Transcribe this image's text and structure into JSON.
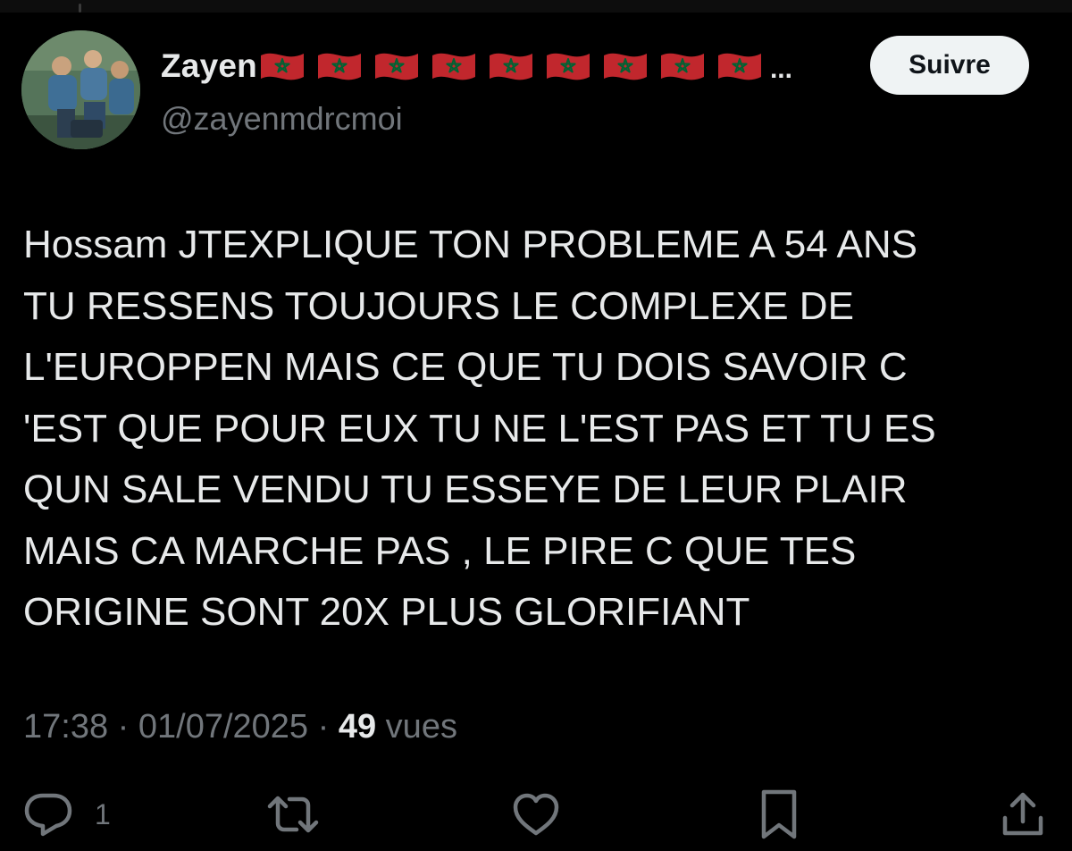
{
  "tweet": {
    "author": {
      "display_name": "Zayen",
      "flag_emoji": "🇲🇦",
      "flag_count": 9,
      "name_overflow": "...",
      "handle": "@zayenmdrcmoi"
    },
    "follow_label": "Suivre",
    "text_lines": [
      "Hossam JTEXPLIQUE TON PROBLEME A 54 ANS",
      "TU RESSENS TOUJOURS LE COMPLEXE DE",
      "L'EUROPPEN MAIS CE QUE TU DOIS SAVOIR C",
      "'EST QUE POUR EUX TU NE L'EST PAS ET TU ES",
      "QUN SALE VENDU TU ESSEYE DE LEUR PLAIR",
      "MAIS CA MARCHE PAS , LE PIRE C QUE TES",
      "ORIGINE SONT 20X PLUS GLORIFIANT"
    ],
    "meta": {
      "time": "17:38",
      "separator": " · ",
      "date": "01/07/2025",
      "views_count": "49",
      "views_label": " vues"
    },
    "actions": {
      "reply_count": "1"
    }
  },
  "icons": {
    "reply": "reply-icon",
    "retweet": "retweet-icon",
    "like": "heart-icon",
    "bookmark": "bookmark-icon",
    "share": "share-icon"
  },
  "colors": {
    "background": "#000000",
    "text_primary": "#e7e9ea",
    "text_secondary": "#71767b",
    "button_bg": "#eff3f4",
    "button_text": "#0f1419",
    "flag_red": "#c1272d",
    "flag_star": "#006233"
  }
}
